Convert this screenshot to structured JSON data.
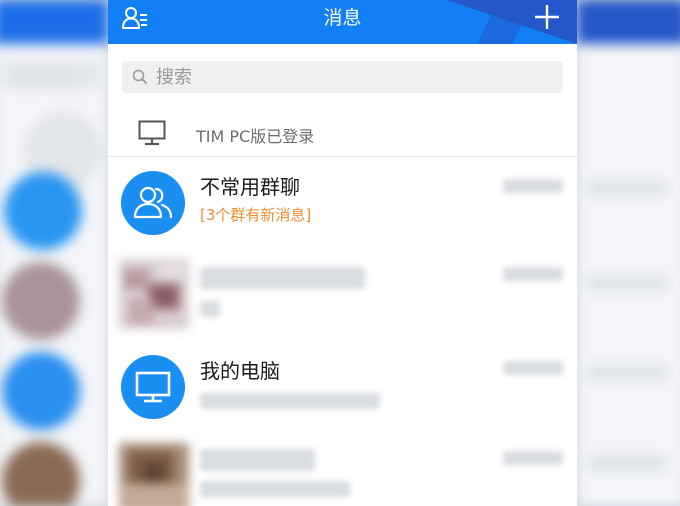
{
  "header": {
    "title": "消息",
    "contacts_icon": "contacts-icon",
    "add_icon": "plus-icon"
  },
  "search": {
    "placeholder": "搜索",
    "icon": "search-icon"
  },
  "pc_status": {
    "icon": "monitor-icon",
    "text": "TIM PC版已登录"
  },
  "conversations": [
    {
      "name": "不常用群聊",
      "subtitle": "[3个群有新消息]",
      "avatar_icon": "group-icon"
    },
    {
      "name": "",
      "subtitle": "",
      "avatar_icon": "blurred-avatar"
    },
    {
      "name": "我的电脑",
      "subtitle": "",
      "avatar_icon": "monitor-icon"
    },
    {
      "name": "",
      "subtitle": "",
      "avatar_icon": "blurred-avatar"
    }
  ],
  "colors": {
    "header_blue": "#127ff5",
    "header_dark": "#2457c9",
    "avatar_blue": "#1b8ef1",
    "highlight_orange": "#ec8e2f"
  }
}
